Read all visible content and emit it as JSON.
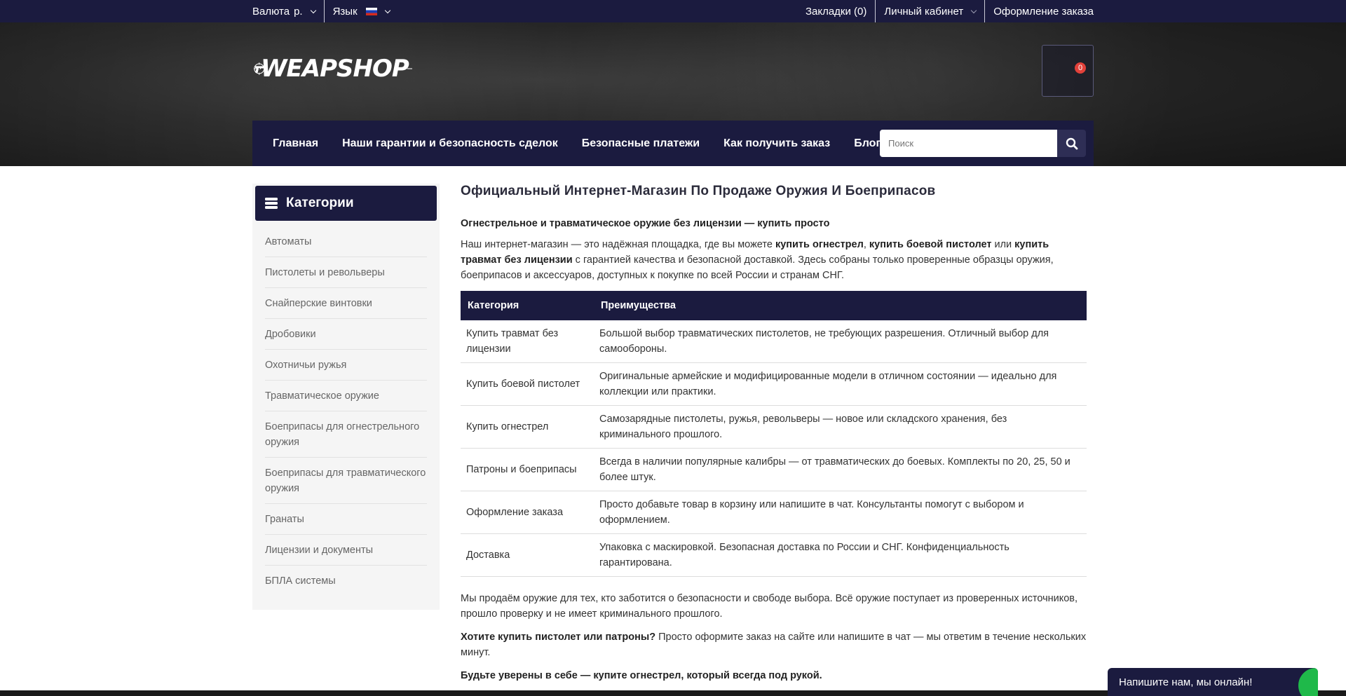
{
  "topbar": {
    "currency_label": "Валюта",
    "currency_value": "р.",
    "language_label": "Язык",
    "bookmarks": "Закладки (0)",
    "account": "Личный кабинет",
    "checkout": "Оформление заказа"
  },
  "header": {
    "logo_text": "WEAPSHOP",
    "cart_count": "0"
  },
  "nav": {
    "items": [
      "Главная",
      "Наши гарантии и безопасность сделок",
      "Безопасные платежи",
      "Как получить заказ",
      "Блог"
    ],
    "search_placeholder": "Поиск"
  },
  "sidebar": {
    "title": "Категории",
    "items": [
      "Автоматы",
      "Пистолеты и револьверы",
      "Снайперские винтовки",
      "Дробовики",
      "Охотничьи ружья",
      "Травматическое оружие",
      "Боеприпасы для огнестрельного оружия",
      "Боеприпасы для травматического оружия",
      "Гранаты",
      "Лицензии и документы",
      "БПЛА системы"
    ]
  },
  "content": {
    "title": "Официальный Интернет-Магазин По Продаже Оружия И Боеприпасов",
    "subtitle": "Огнестрельное и травматическое оружие без лицензии — купить просто",
    "intro": {
      "t1": "Наш интернет-магазин — это надёжная площадка, где вы можете ",
      "b1": "купить огнестрел",
      "t2": ", ",
      "b2": "купить боевой пистолет",
      "t3": " или ",
      "b3": "купить травмат без лицензии",
      "t4": " с гарантией качества и безопасной доставкой. Здесь собраны только проверенные образцы оружия, боеприпасов и аксессуаров, доступных к покупке по всей России и странам СНГ."
    },
    "table": {
      "headers": [
        "Категория",
        "Преимущества"
      ],
      "rows": [
        [
          "Купить травмат без лицензии",
          "Большой выбор травматических пистолетов, не требующих разрешения. Отличный выбор для самообороны."
        ],
        [
          "Купить боевой пистолет",
          "Оригинальные армейские и модифицированные модели в отличном состоянии — идеально для коллекции или практики."
        ],
        [
          "Купить огнестрел",
          "Самозарядные пистолеты, ружья, револьверы — новое или складского хранения, без криминального прошлого."
        ],
        [
          "Патроны и боеприпасы",
          "Всегда в наличии популярные калибры — от травматических до боевых. Комплекты по 20, 25, 50 и более штук."
        ],
        [
          "Оформление заказа",
          "Просто добавьте товар в корзину или напишите в чат. Консультанты помогут с выбором и оформлением."
        ],
        [
          "Доставка",
          "Упаковка с маскировкой. Безопасная доставка по России и СНГ. Конфиденциальность гарантирована."
        ]
      ]
    },
    "para2": "Мы продаём оружие для тех, кто заботится о безопасности и свободе выбора. Всё оружие поступает из проверенных источников, прошло проверку и не имеет криминального прошлого.",
    "para3_bold": "Хотите купить пистолет или патроны?",
    "para3_rest": " Просто оформите заказ на сайте или напишите в чат — мы ответим в течение нескольких минут.",
    "para4": "Будьте уверены в себе — купите огнестрел, который всегда под рукой."
  },
  "chat": {
    "label": "Напишите нам, мы онлайн!"
  }
}
